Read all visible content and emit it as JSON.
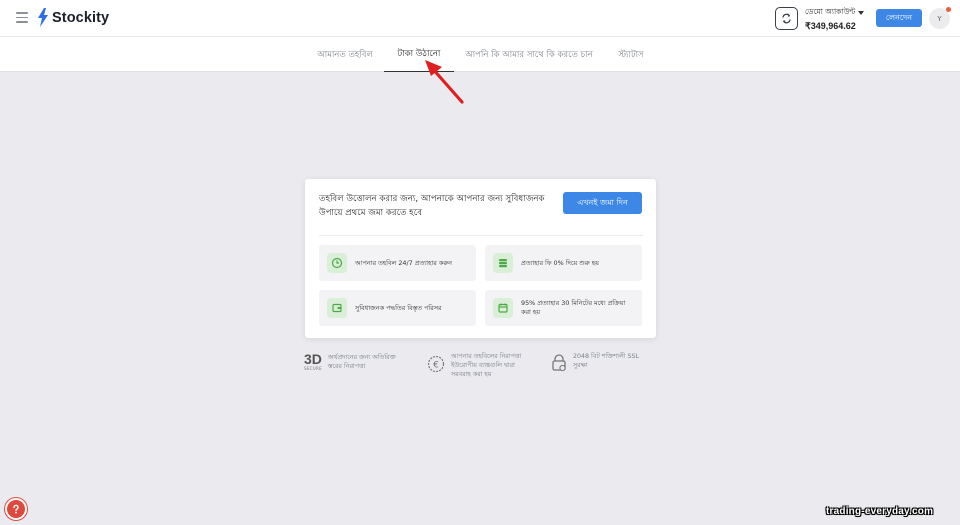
{
  "header": {
    "logo_text": "Stockity",
    "account": {
      "name": "ডেমো অ্যাকাউন্ট",
      "balance": "₹349,964.62"
    },
    "transactions_label": "লেনদেন",
    "avatar_letter": "Y"
  },
  "tabs": [
    {
      "label": "আমানত তহবিল",
      "active": false
    },
    {
      "label": "টাকা উঠানো",
      "active": true
    },
    {
      "label": "আপনি কি আমার সাথে কি করতে চান",
      "active": false
    },
    {
      "label": "স্ট্যাটাস",
      "active": false
    }
  ],
  "card": {
    "message": "তহবিল উত্তোলন করার জন্য, আপনাকে আপনার জন্য সুবিধাজনক উপায়ে প্রথমে জমা করতে হবে",
    "deposit_button": "এখনই জমা দিন",
    "features": [
      {
        "icon": "clock-icon",
        "text": "আপনার তহবিল 24/7 প্রত্যাহার করুন"
      },
      {
        "icon": "coins-icon",
        "text": "প্রত্যাহার ফি 0% দিয়ে শুরু হয়"
      },
      {
        "icon": "wallet-icon",
        "text": "সুবিধাজনক পদ্ধতির বিস্তৃত পরিসর"
      },
      {
        "icon": "calendar-icon",
        "text": "95% প্রত্যাহার 30 মিনিটের মধ্যে প্রক্রিয়া করা হয়"
      }
    ]
  },
  "trust": [
    {
      "badge": "3D",
      "badge_sub": "SECURE",
      "text": "অর্থপ্রদানের জন্য অতিরিক্ত স্তরের নিরাপত্তা"
    },
    {
      "icon": "euro-shield-icon",
      "text": "আপনার তহবিলের নিরাপত্তা ইউরোপীয় ব্যাঙ্কগুলি দ্বারা সরবরাহ করা হয়"
    },
    {
      "icon": "lock-icon",
      "text": "2048 বিট শক্তিশালী SSL সুরক্ষা"
    }
  ],
  "watermark": "trading-everyday.com",
  "colors": {
    "accent": "#3d87e6",
    "logo": "#2f6de0",
    "arrow": "#e02020",
    "feature_icon_bg": "#d9efd7",
    "feature_icon": "#4fa84a",
    "help": "#e0483e"
  }
}
